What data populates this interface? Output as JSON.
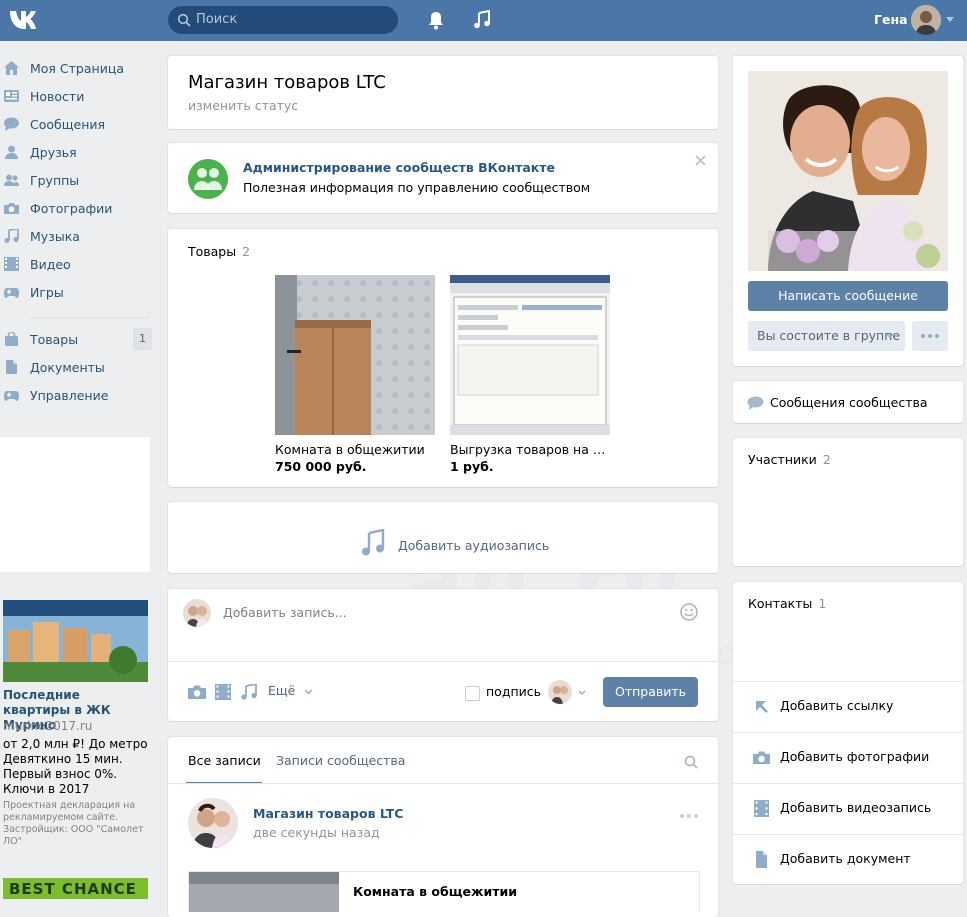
{
  "header": {
    "search_placeholder": "Поиск",
    "user_name": "Гена"
  },
  "nav": [
    {
      "label": "Моя Страница",
      "icon": "home-icon"
    },
    {
      "label": "Новости",
      "icon": "news-icon"
    },
    {
      "label": "Сообщения",
      "icon": "messages-icon"
    },
    {
      "label": "Друзья",
      "icon": "friends-icon"
    },
    {
      "label": "Группы",
      "icon": "groups-icon"
    },
    {
      "label": "Фотографии",
      "icon": "camera-icon"
    },
    {
      "label": "Музыка",
      "icon": "music-icon"
    },
    {
      "label": "Видео",
      "icon": "video-icon"
    },
    {
      "label": "Игры",
      "icon": "gamepad-icon"
    }
  ],
  "nav2": [
    {
      "label": "Товары",
      "icon": "bag-icon",
      "badge": "1"
    },
    {
      "label": "Документы",
      "icon": "document-icon"
    },
    {
      "label": "Управление",
      "icon": "gamepad-icon"
    }
  ],
  "ad": {
    "title": "Последние квартиры в ЖК Мурино",
    "domain": "murino2017.ru",
    "text": "от 2,0 млн ₽! До метро Девяткино 15 мин. Первый взнос 0%. Ключи в 2017",
    "disclaimer": "Проектная декларация на рекламируемом сайте. Застройщик: ООО \"Самолет ЛО\"",
    "banner_text": "BEST CHANCE"
  },
  "page": {
    "title": "Магазин товаров LTC",
    "status": "изменить статус"
  },
  "admin_banner": {
    "title": "Администрирование сообществ ВКонтакте",
    "subtitle": "Полезная информация по управлению сообществом"
  },
  "goods": {
    "label": "Товары",
    "count": "2",
    "items": [
      {
        "name": "Комната в общежитии",
        "price": "750 000 руб."
      },
      {
        "name": "Выгрузка товаров на сайт",
        "price": "1 руб."
      }
    ]
  },
  "audio": {
    "label": "Добавить аудиозапись"
  },
  "composer": {
    "placeholder": "Добавить запись...",
    "more": "Ещё",
    "signature": "подпись",
    "send": "Отправить"
  },
  "wall": {
    "tabs": [
      "Все записи",
      "Записи сообщества"
    ],
    "post": {
      "author": "Магазин товаров LTC",
      "time": "две секунды назад",
      "attachment_title": "Комната в общежитии"
    }
  },
  "right": {
    "write_message": "Написать сообщение",
    "member_status": "Вы состоите в группе",
    "community_messages": "Сообщения сообщества",
    "members_label": "Участники",
    "members_count": "2",
    "contacts_label": "Контакты",
    "contacts_count": "1",
    "links": [
      {
        "label": "Добавить ссылку",
        "icon": "link-icon"
      },
      {
        "label": "Добавить фотографии",
        "icon": "camera-icon"
      },
      {
        "label": "Добавить видеозапись",
        "icon": "video-icon"
      },
      {
        "label": "Добавить документ",
        "icon": "document-icon"
      }
    ]
  },
  "colors": {
    "header": "#4a76a8",
    "link": "#2a5885",
    "button": "#5e81a8",
    "background": "#edeef0"
  }
}
